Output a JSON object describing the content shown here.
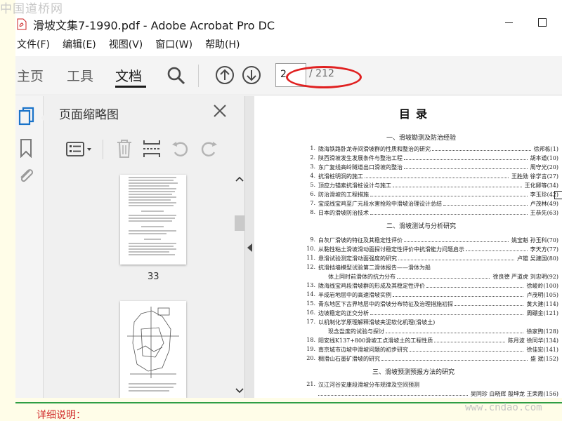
{
  "watermark_top": "中国道桥网",
  "watermark_bottom": "www.cndao.com",
  "window": {
    "title": "滑坡文集7-1990.pdf - Adobe Acrobat Pro DC"
  },
  "menu": [
    "文件(F)",
    "编辑(E)",
    "视图(V)",
    "窗口(W)",
    "帮助(H)"
  ],
  "toolbar": {
    "tabs": [
      "主页",
      "工具",
      "文档"
    ],
    "active_tab": "文档",
    "page_current": "2",
    "page_total": "/ 212"
  },
  "panel": {
    "title": "页面缩略图",
    "thumb_page_number": "33"
  },
  "document": {
    "heading": "目录",
    "sections": [
      "一、滑坡勘测及防治经验",
      "二、滑坡测试与分析研究",
      "三、滑坡预测预报方法的研究"
    ],
    "entries": [
      {
        "num": "1.",
        "title": "陇海铁路卧龙寺间滑坡群的性质和整治的研究",
        "author": "徐邦栋(1)"
      },
      {
        "num": "2.",
        "title": "陕西滑坡发生发展条件与整治工程",
        "author": "胡本道(10)"
      },
      {
        "num": "3.",
        "title": "东广复线高岭隧道出口滑坡的整治",
        "author": "周守光(20)"
      },
      {
        "num": "4.",
        "title": "抗滑桩明洞的施工",
        "author": "王胜勋 徐学言(27)"
      },
      {
        "num": "5.",
        "title": "顶应力锚索抗滑桩设计与施工",
        "author": "王化卿等(34)"
      },
      {
        "num": "6.",
        "title": "防治滑坡的工程措施",
        "author": "李玉珍(42)"
      },
      {
        "num": "7.",
        "title": "宝成线宝鸡至广元段水害抢险中滑坡治理设计总结",
        "author": "卢茂林(49)"
      },
      {
        "num": "8.",
        "title": "日本的滑坡防治技术",
        "author": "王恭先(63)"
      },
      {
        "num": "9.",
        "title": "白灰厂滑坡的特征及其稳定性评价",
        "author": "姚宝魁 孙玉科(70)"
      },
      {
        "num": "10.",
        "title": "从黏性粘土滑坡滑动面探讨稳定性评价中抗滑能力问题启示",
        "author": "李天方(77)"
      },
      {
        "num": "11.",
        "title": "悬滑试验测定滑动面强度的研究",
        "author": "卢雄 吴建国(80)"
      },
      {
        "num": "12.",
        "title": "抗滑挡墙模型试验第二滑体报告——滑体为船",
        "author": ""
      },
      {
        "num": "",
        "title": "体上同时前滑体的抗力分布",
        "author": "徐良德 严道虎 刘忠明(92)"
      },
      {
        "num": "13.",
        "title": "陇海线宝鸡段滑坡群的形成及其稳定性评价",
        "author": "徐峻岭(100)"
      },
      {
        "num": "14.",
        "title": "半成岩地层中的高速滑坡实例",
        "author": "卢茂明(105)"
      },
      {
        "num": "15.",
        "title": "青东地区下古界地层中的滑坡分布特征及治理措施初探",
        "author": "黄大建(114)"
      },
      {
        "num": "16.",
        "title": "边坡稳定的正交分析",
        "author": "周硼金(121)"
      },
      {
        "num": "17.",
        "title": "以机制化学原理解释滑坡夹泥软化机理(滑坡土)",
        "author": ""
      },
      {
        "num": "",
        "title": "现含盐度的试验与探讨",
        "author": "徐家煦(128)"
      },
      {
        "num": "18.",
        "title": "阳安线K137+800滑坡工点滑坡土的工程性质",
        "author": "陈月波 徐同华(134)"
      },
      {
        "num": "19.",
        "title": "南京城市边坡中滑坡问题的初步研究",
        "author": "徐佳宏(141)"
      },
      {
        "num": "20.",
        "title": "稠滑山石墨矿滑坡的研究",
        "author": "盛 斌(152)"
      },
      {
        "num": "21.",
        "title": "汉江河谷安康段滑坡分布规律及空间预测",
        "author": ""
      },
      {
        "num": "",
        "title": "",
        "author": "吴同珍 白晓辉 殷坤龙 王荣霞(156)"
      }
    ]
  },
  "footer": {
    "detail_label": "详细说明："
  },
  "colors": {
    "accent_red": "#e02020",
    "watermark": "#c8c8c8",
    "footer_green": "#2f9e44"
  }
}
